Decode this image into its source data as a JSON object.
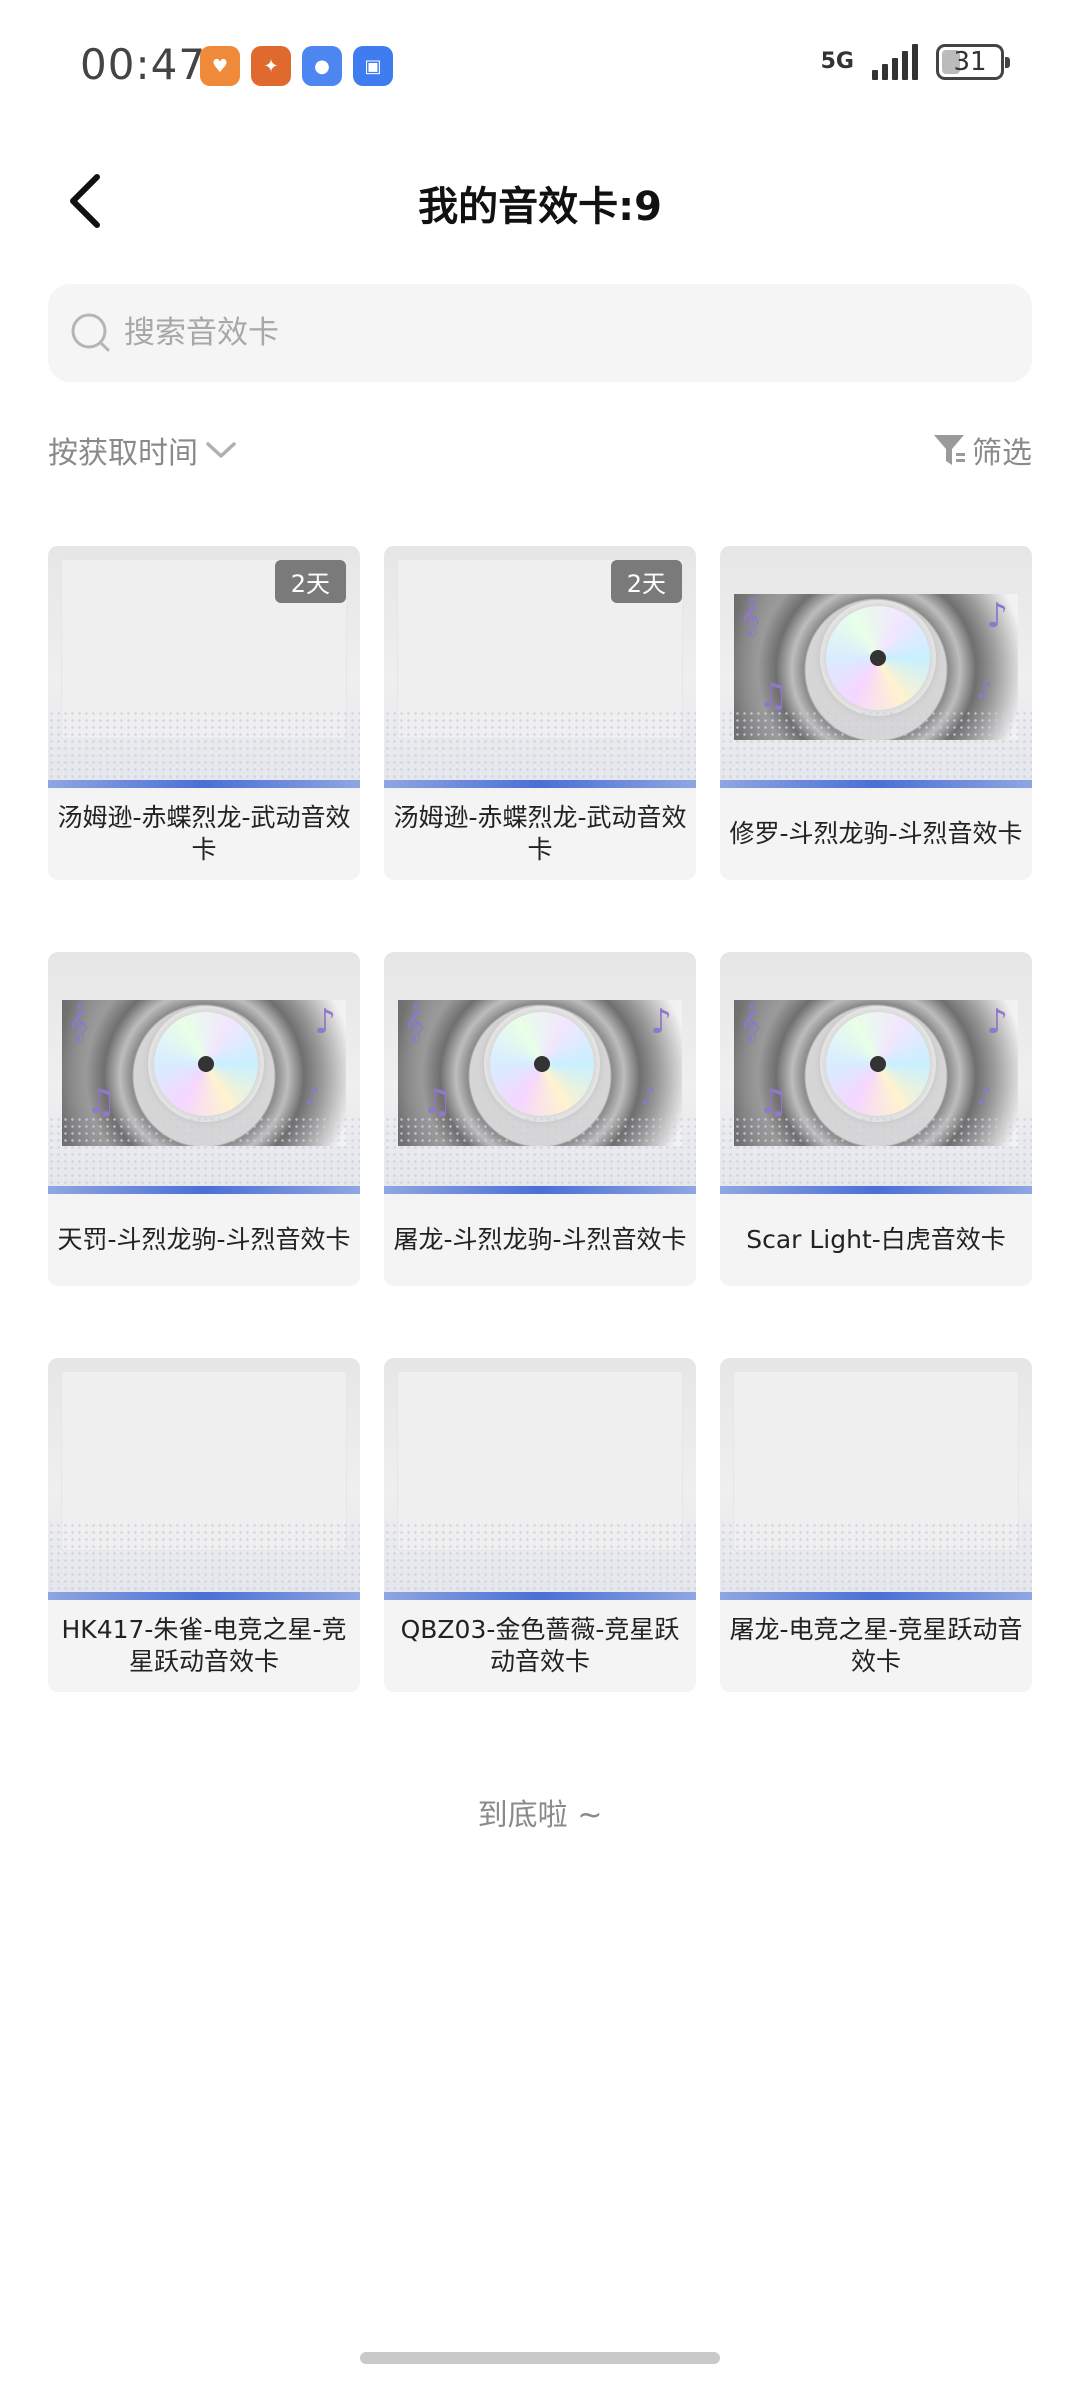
{
  "status_bar": {
    "time": "00:47",
    "network": "5G",
    "battery": "31",
    "app_icons": [
      "health-app-icon",
      "cf-game-icon",
      "messages-icon",
      "app-market-icon"
    ]
  },
  "header": {
    "title": "我的音效卡:9",
    "back_icon": "chevron-left-icon"
  },
  "search": {
    "placeholder": "搜索音效卡",
    "value": ""
  },
  "sort": {
    "label": "按获取时间",
    "icon": "chevron-down-icon"
  },
  "filter": {
    "label": "筛选",
    "icon": "funnel-icon"
  },
  "cards": [
    {
      "name": "汤姆逊-赤蝶烈龙-武动音效卡",
      "badge": "2天",
      "image": "blank"
    },
    {
      "name": "汤姆逊-赤蝶烈龙-武动音效卡",
      "badge": "2天",
      "image": "blank"
    },
    {
      "name": "修罗-斗烈龙驹-斗烈音效卡",
      "badge": "",
      "image": "disc"
    },
    {
      "name": "天罚-斗烈龙驹-斗烈音效卡",
      "badge": "",
      "image": "disc"
    },
    {
      "name": "屠龙-斗烈龙驹-斗烈音效卡",
      "badge": "",
      "image": "disc"
    },
    {
      "name": "Scar Light-白虎音效卡",
      "badge": "",
      "image": "disc"
    },
    {
      "name": "HK417-朱雀-电竞之星-竞星跃动音效卡",
      "badge": "",
      "image": "blank"
    },
    {
      "name": "QBZ03-金色蔷薇-竞星跃动音效卡",
      "badge": "",
      "image": "blank"
    },
    {
      "name": "屠龙-电竞之星-竞星跃动音效卡",
      "badge": "",
      "image": "blank"
    }
  ],
  "footer": {
    "end_text": "到底啦 ~"
  },
  "colors": {
    "accent_blue": "#4a6fd6",
    "card_bg": "#f4f4f4",
    "badge_bg": "#7a7a7a",
    "note_purple": "#8d78c9"
  }
}
